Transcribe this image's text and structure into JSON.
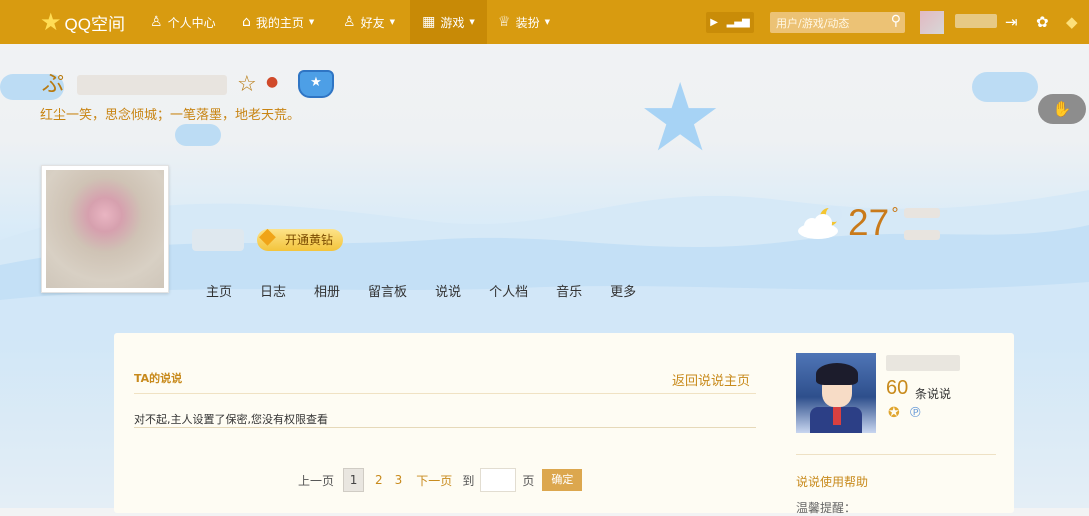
{
  "topbar": {
    "logo_text": "QQ空间",
    "nav": [
      {
        "label": "个人中心",
        "icon": "person-icon"
      },
      {
        "label": "我的主页",
        "icon": "home-icon"
      },
      {
        "label": "好友",
        "icon": "friends-icon"
      },
      {
        "label": "游戏",
        "icon": "grid-icon"
      },
      {
        "label": "装扮",
        "icon": "shirt-icon"
      }
    ],
    "search_placeholder": "用户/游戏/动态"
  },
  "cover": {
    "owner_name_suffix": "☆",
    "signature": "红尘一笑，思念倾城；一笔落墨，地老天荒。",
    "weather_temp": "27",
    "vip_button": "开通黄钻"
  },
  "tabs": [
    "主页",
    "日志",
    "相册",
    "留言板",
    "说说",
    "个人档",
    "音乐",
    "更多"
  ],
  "content": {
    "section_title": "TA的说说",
    "back_link": "返回说说主页",
    "no_permission": "对不起,主人设置了保密,您没有权限查看",
    "pager": {
      "prev": "上一页",
      "current": "1",
      "pages": [
        "2",
        "3"
      ],
      "next": "下一页",
      "goto": "到",
      "page_unit": "页",
      "confirm": "确定"
    }
  },
  "sidebar": {
    "count": "60",
    "count_label": "条说说",
    "help": "说说使用帮助",
    "help_next": "温馨提醒："
  },
  "colors": {
    "topbar": "#d89b10",
    "accent": "#c88a1c",
    "panel": "#fefcf3"
  }
}
